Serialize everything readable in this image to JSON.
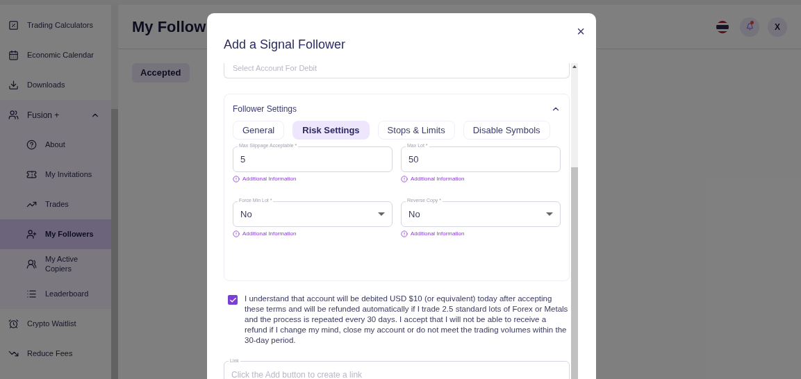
{
  "sidebar": {
    "items": [
      {
        "label": "Trading Calculators",
        "selected": false
      },
      {
        "label": "Economic Calendar",
        "selected": false
      },
      {
        "label": "Downloads",
        "selected": false
      },
      {
        "label": "Fusion +",
        "expanded": true,
        "children": [
          {
            "label": "About",
            "selected": false
          },
          {
            "label": "My Invitations",
            "selected": false
          },
          {
            "label": "Trades",
            "selected": false
          },
          {
            "label": "My Followers",
            "selected": true
          },
          {
            "label": "My Active Copiers",
            "selected": false
          },
          {
            "label": "Leaderboard",
            "selected": false
          }
        ]
      },
      {
        "label": "Crypto Waitlist",
        "selected": false
      },
      {
        "label": "Reduce Fees",
        "selected": false
      }
    ]
  },
  "page": {
    "title": "My Follow",
    "tabs": [
      {
        "label": "Accepted",
        "selected": true
      }
    ],
    "header": {
      "avatar": "X",
      "notification": true
    }
  },
  "dialog": {
    "title": "Add a Signal Follower",
    "close": "×",
    "account_select": {
      "placeholder": "Select Account For Debit"
    },
    "settings": {
      "title": "Follower Settings",
      "expanded": true,
      "tabs": [
        {
          "label": "General",
          "selected": false
        },
        {
          "label": "Risk Settings",
          "selected": true
        },
        {
          "label": "Stops & Limits",
          "selected": false
        },
        {
          "label": "Disable Symbols",
          "selected": false
        }
      ],
      "fields": [
        {
          "kind": "text",
          "label": "Max Slippage Acceptable *",
          "value": "5",
          "help": "Additional Information"
        },
        {
          "kind": "text",
          "label": "Max Lot *",
          "value": "50",
          "help": "Additional Information"
        },
        {
          "kind": "select",
          "label": "Force Min Lot *",
          "value": "No",
          "help": "Additional Information"
        },
        {
          "kind": "select",
          "label": "Reverse Copy *",
          "value": "No",
          "help": "Additional Information"
        }
      ]
    },
    "terms": {
      "checked": true,
      "text": "I understand that account will be debited USD $10 (or equivalent) today after accepting these terms and will be refunded automatically if I trade 2.5 standard lots of Forex or Metals and the process is repeated every 30 days. I accept that I will not be able to receive a refund if I change my mind, close my account or do not meet the trading volumes within the 30-day period."
    },
    "link": {
      "label": "Link",
      "placeholder": "Click the Add button to create a link"
    }
  }
}
